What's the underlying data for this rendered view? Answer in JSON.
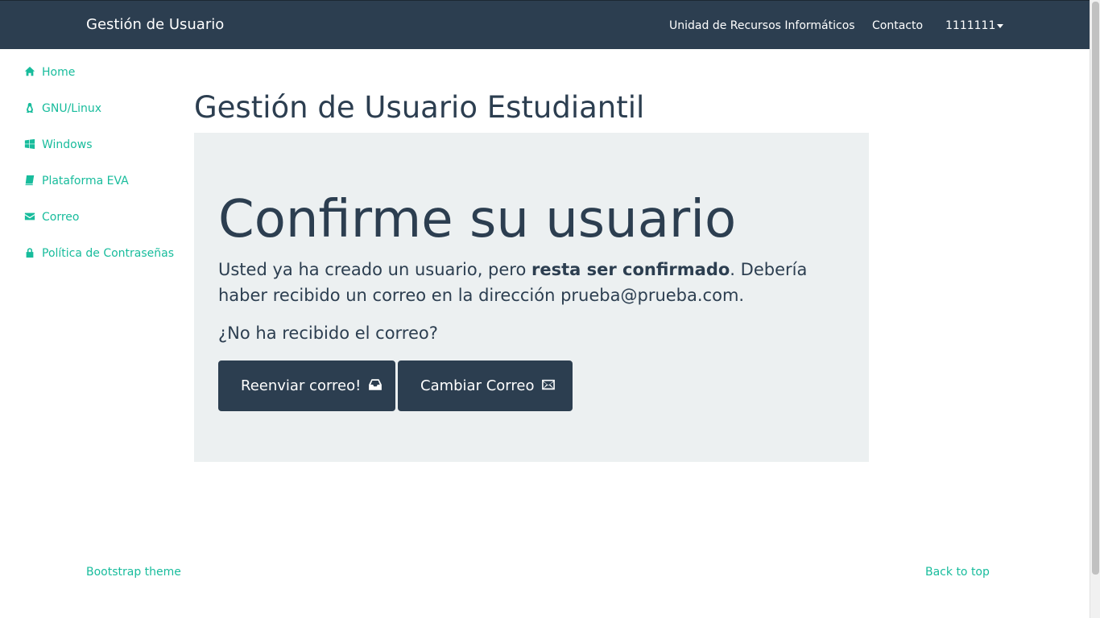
{
  "navbar": {
    "brand": "Gestión de Usuario",
    "links": {
      "unidad": "Unidad de Recursos Informáticos",
      "contacto": "Contacto",
      "user": "1111111"
    }
  },
  "sidebar": {
    "items": [
      {
        "label": "Home",
        "icon": "home-icon"
      },
      {
        "label": "GNU/Linux",
        "icon": "linux-icon"
      },
      {
        "label": "Windows",
        "icon": "windows-icon"
      },
      {
        "label": "Plataforma EVA",
        "icon": "book-icon"
      },
      {
        "label": "Correo",
        "icon": "envelope-icon"
      },
      {
        "label": "Política de Contraseñas",
        "icon": "lock-icon"
      }
    ]
  },
  "main": {
    "title": "Gestión de Usuario Estudiantil",
    "jumbotron": {
      "heading": "Confirme su usuario",
      "text_before": "Usted ya ha creado un usuario, pero ",
      "text_bold": "resta ser confirmado",
      "text_after": ". Debería haber recibido un correo en la dirección prueba@prueba.com.",
      "question": "¿No ha recibido el correo?",
      "resend_label": "Reenviar correo!",
      "change_label": "Cambiar Correo"
    }
  },
  "footer": {
    "left": "Bootstrap theme",
    "right": "Back to top"
  },
  "colors": {
    "navbar": "#2c3e50",
    "link": "#18bc9c",
    "jumbotron": "#ecf0f1",
    "button": "#2c3e50"
  }
}
